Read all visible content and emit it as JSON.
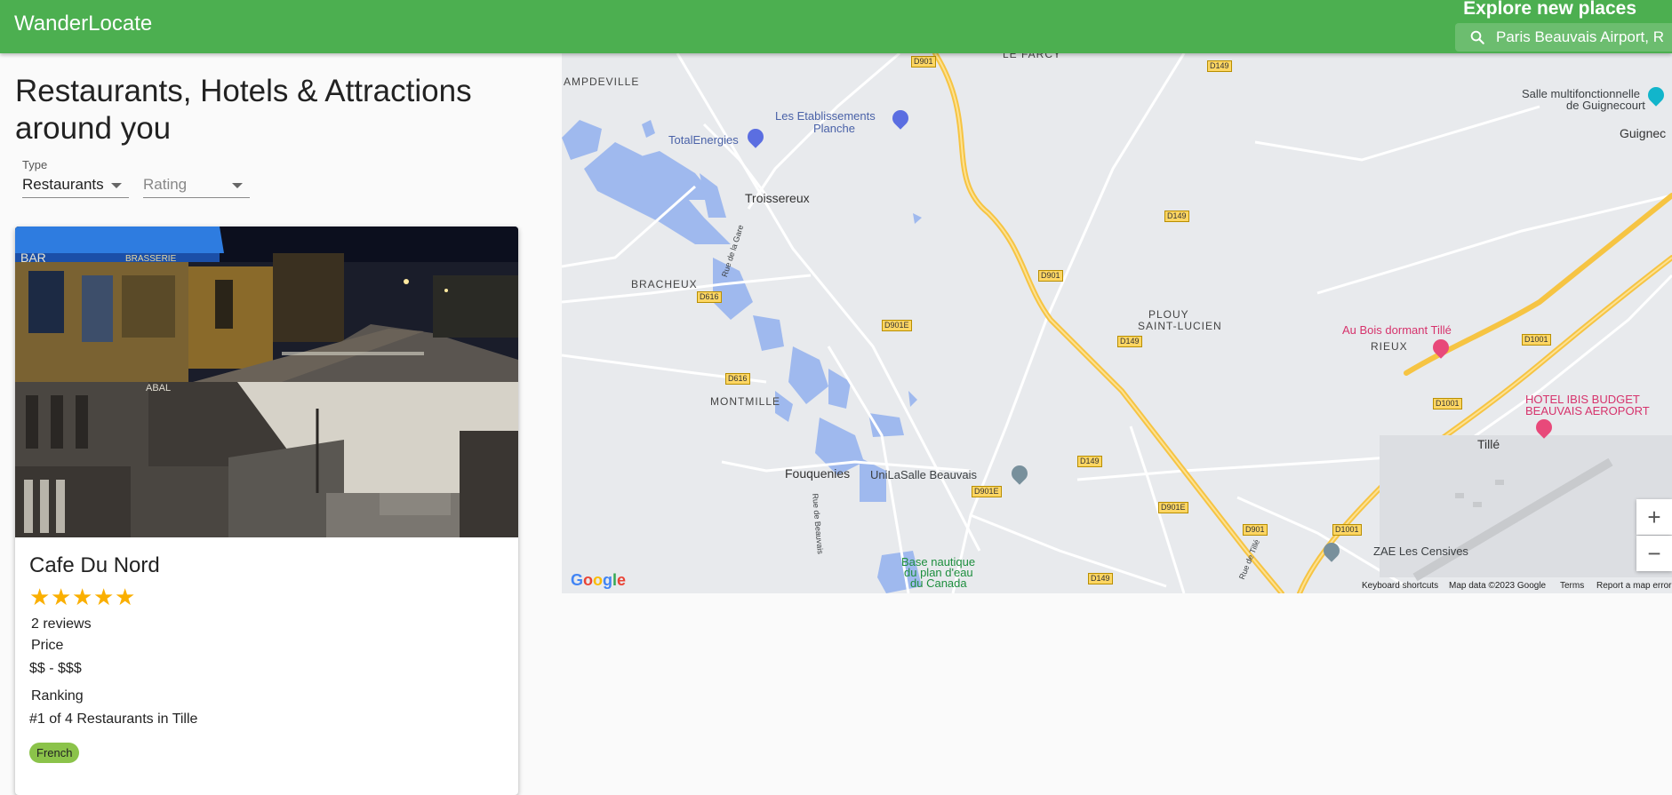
{
  "app": {
    "brand": "WanderLocate",
    "explore_label": "Explore new places"
  },
  "search": {
    "value": "Paris Beauvais Airport, R",
    "icon": "search-icon"
  },
  "heading": "Restaurants, Hotels & Attractions around you",
  "filters": {
    "type": {
      "label": "Type",
      "value": "Restaurants"
    },
    "rating": {
      "label": "Rating",
      "placeholder": "Rating"
    }
  },
  "place": {
    "name": "Cafe Du Nord",
    "rating": 5,
    "reviews": "2 reviews",
    "price_label": "Price",
    "price_value": "$$ - $$$",
    "ranking_label": "Ranking",
    "ranking_value": "#1 of 4 Restaurants in Tille",
    "cuisine": "French",
    "photo_sign_top": "BAR",
    "photo_sign_brasserie": "BRASSERIE",
    "photo_sign_bottom": "ABAL"
  },
  "map": {
    "places": [
      "LE FARCY",
      "AMPDEVILLE",
      "Les Etablissements",
      "Planche",
      "TotalEnergies",
      "Troissereux",
      "BRACHEUX",
      "PLOUY",
      "SAINT-LUCIEN",
      "Au Bois dormant Tillé",
      "RIEUX",
      "HOTEL IBIS BUDGET",
      "BEAUVAIS AEROPORT",
      "Tillé",
      "MONTMILLE",
      "Fouquenies",
      "UniLaSalle Beauvais",
      "ZAE Les Censives",
      "Base nautique",
      "du plan d'eau",
      "du Canada",
      "Salle multifonctionnelle",
      "de Guignecourt",
      "Guignec",
      "Rue de la Gare",
      "Rue de Beauvais",
      "Rue de Tillé"
    ],
    "roads": [
      "D901",
      "D149",
      "D901E",
      "D616",
      "D1001"
    ],
    "zoom_in": "+",
    "zoom_out": "−",
    "google": "Google",
    "keyboard_shortcuts": "Keyboard shortcuts",
    "map_data": "Map data ©2023 Google",
    "terms": "Terms",
    "report": "Report a map error"
  },
  "colors": {
    "appbar": "#4caf50",
    "chip": "#8bc34a",
    "star": "#faaf00",
    "water": "#9fb9ee",
    "highway": "#f6c443"
  }
}
